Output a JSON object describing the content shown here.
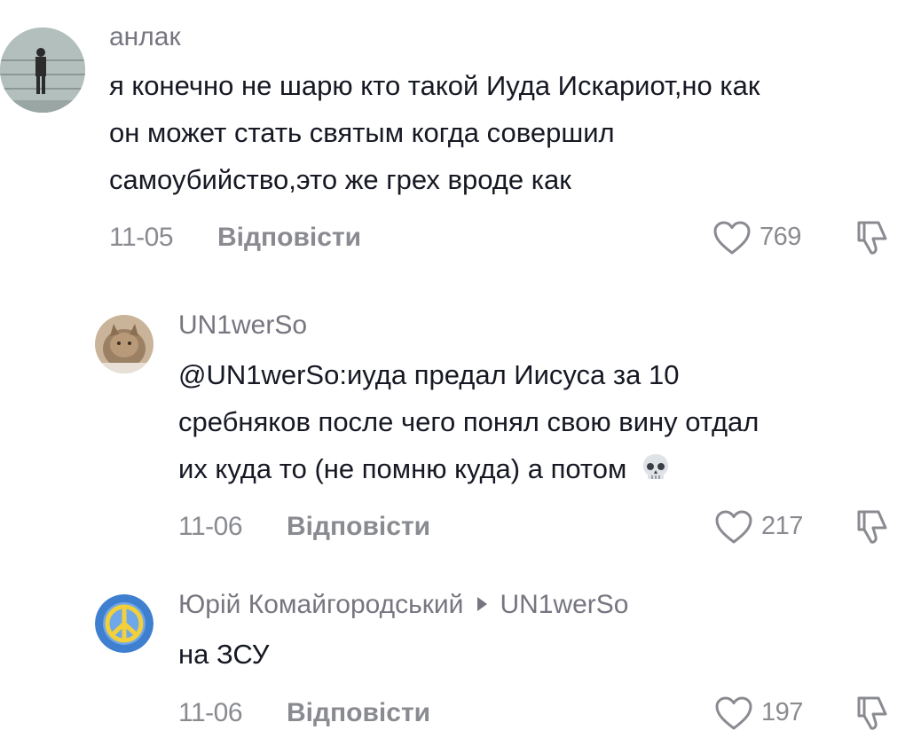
{
  "comments": [
    {
      "username": "анлак",
      "lines": [
        "я конечно не шарю кто такой Иуда Искариот,но как",
        "он может стать святым когда совершил",
        "самоубийство,это же грех вроде как"
      ],
      "date": "11-05",
      "reply_label": "Відповісти",
      "likes": "769"
    },
    {
      "username": "UN1werSo",
      "lines": [
        "@UN1werSo:иуда предал Иисуса за 10",
        "сребняков после чего понял свою вину отдал",
        "их куда то (не помню куда) а потом"
      ],
      "emoji": "skull",
      "date": "11-06",
      "reply_label": "Відповісти",
      "likes": "217"
    },
    {
      "username": "Юрій Комайгородський",
      "reply_to": "UN1werSo",
      "lines": [
        "на ЗСУ"
      ],
      "date": "11-06",
      "reply_label": "Відповісти",
      "likes": "197"
    }
  ],
  "icons": {
    "like": "heart-outline-icon",
    "dislike": "thumbs-down-outline-icon",
    "reply_arrow": "triangle-right-icon"
  },
  "colors": {
    "text": "#161823",
    "muted": "#8a8b91"
  }
}
